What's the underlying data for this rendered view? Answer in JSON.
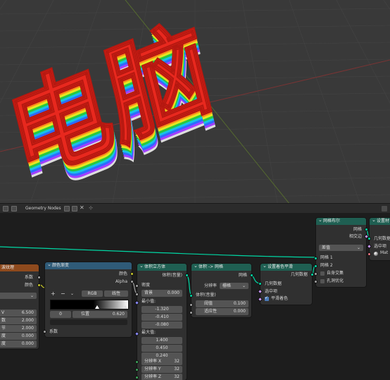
{
  "viewport": {
    "text_3d": "电脑",
    "colors": {
      "background": "#393939",
      "grid": "#444444",
      "axis_x": "#7a3434",
      "axis_y": "#556b2f",
      "layers": [
        "#dddddd",
        "#a040ff",
        "#2c6cff",
        "#17c2e6",
        "#28c940",
        "#e6e620",
        "#ff8a1a",
        "#e8281e"
      ]
    }
  },
  "editor": {
    "title": "Geometry Nodes",
    "close_glyph": "✕",
    "pin_glyph": "⊹"
  },
  "nodes": {
    "wave": {
      "title": "波纹理",
      "out_color": "系数",
      "out_fac": "颜色",
      "fields": [
        {
          "label": "V",
          "value": "6.500"
        },
        {
          "label": "数",
          "value": "2.000"
        },
        {
          "label": "节",
          "value": "2.000"
        },
        {
          "label": "度",
          "value": "0.000"
        },
        {
          "label": "度",
          "value": "0.000"
        }
      ]
    },
    "ramp": {
      "title": "颜色渐变",
      "out_color": "颜色",
      "out_alpha": "Alpha",
      "add": "+",
      "remove": "−",
      "more": "⌄",
      "mode": "RGB",
      "interp": "线性",
      "stop_index": "0",
      "pos_label": "位置",
      "pos_value": "0.620",
      "in_fac": "系数"
    },
    "cube": {
      "title": "体积立方体",
      "out_volume": "体积(音量)",
      "in_density": "密度",
      "background_label": "背景",
      "background_value": "0.000",
      "min_label": "最小值:",
      "min": [
        "-1.320",
        "-0.410",
        "-0.080"
      ],
      "max_label": "最大值:",
      "max": [
        "1.400",
        "0.450",
        "0.240"
      ],
      "res": [
        {
          "label": "分辨率 X",
          "value": "32"
        },
        {
          "label": "分辨率 Y",
          "value": "32"
        },
        {
          "label": "分辨率 Z",
          "value": "32"
        }
      ]
    },
    "v2m": {
      "title": "体积 -> 网格",
      "out_mesh": "网格",
      "res_label": "分辨率",
      "res_value": "栅格",
      "in_volume": "体积(音量)",
      "threshold_label": "阈值",
      "threshold_value": "0.100",
      "adapt_label": "适应性",
      "adapt_value": "0.000"
    },
    "smooth": {
      "title": "设置着色平滑",
      "out_geo": "几何数据",
      "in_geo": "几何数据",
      "in_sel": "选中项",
      "in_smooth": "平滑着色"
    },
    "bool": {
      "title": "网格布尔",
      "out_mesh": "网格",
      "out_intersect": "相交边",
      "mode": "差值",
      "in_mesh1": "网格 1",
      "in_mesh2": "网格 2",
      "self_intersect": "自身交集",
      "hole_tolerant": "孔洞优化"
    },
    "setmat": {
      "title": "设置材",
      "in_geo": "几何数据",
      "in_sel": "选中项",
      "mat": "Mat"
    }
  }
}
